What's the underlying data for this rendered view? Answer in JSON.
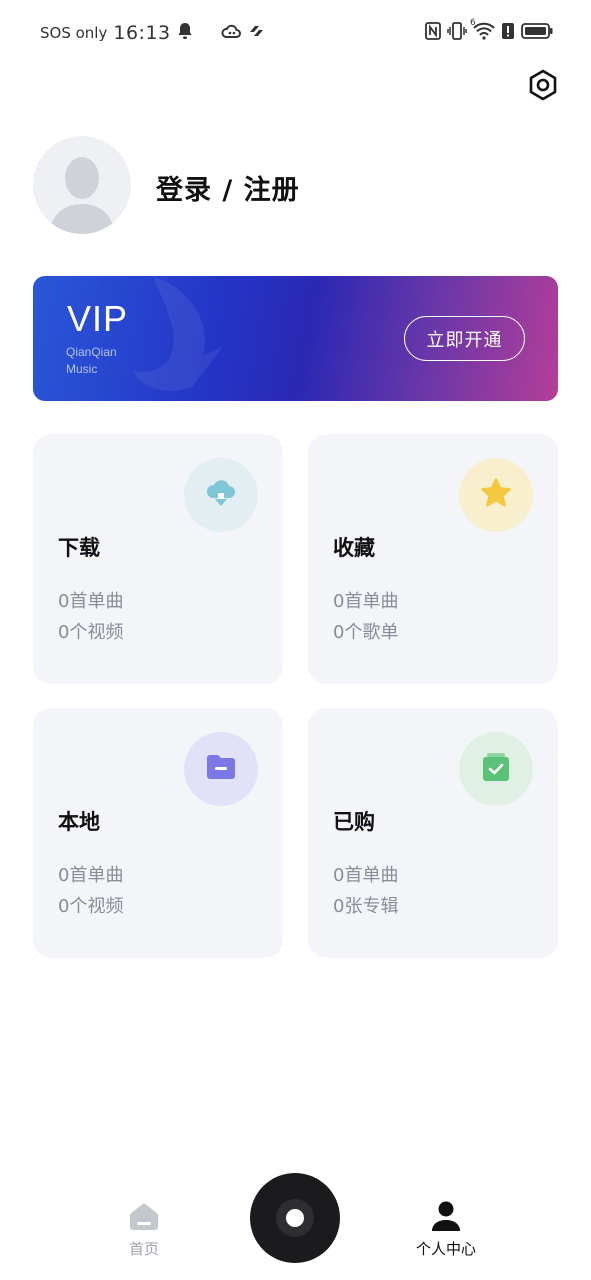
{
  "status_bar": {
    "carrier": "SOS only",
    "time": "16:13",
    "network_superscript": "6"
  },
  "profile": {
    "login_label": "登录 / 注册"
  },
  "vip": {
    "title": "VIP",
    "brand_line1": "QianQian",
    "brand_line2": "Music",
    "cta_label": "立即开通"
  },
  "cards": {
    "download": {
      "title": "下载",
      "line1": "0首单曲",
      "line2": "0个视频",
      "icon": "cloud-download-icon",
      "icon_bg": "#e3eef3",
      "icon_color": "#7fc6d6"
    },
    "favorites": {
      "title": "收藏",
      "line1": "0首单曲",
      "line2": "0个歌单",
      "icon": "star-icon",
      "icon_bg": "#f8efcf",
      "icon_color": "#f5c842"
    },
    "local": {
      "title": "本地",
      "line1": "0首单曲",
      "line2": "0个视频",
      "icon": "folder-icon",
      "icon_bg": "#e1e2f8",
      "icon_color": "#7b78e6"
    },
    "purchased": {
      "title": "已购",
      "line1": "0首单曲",
      "line2": "0张专辑",
      "icon": "shopping-bag-check-icon",
      "icon_bg": "#e0f0e4",
      "icon_color": "#5cc27a"
    }
  },
  "bottom_nav": {
    "home_label": "首页",
    "profile_label": "个人中心",
    "active_tab": "个人中心"
  },
  "colors": {
    "vip_gradient_start": "#2a57d8",
    "vip_gradient_end": "#b43e98",
    "card_bg": "#f4f5f9",
    "secondary_text": "#8a8d96"
  }
}
